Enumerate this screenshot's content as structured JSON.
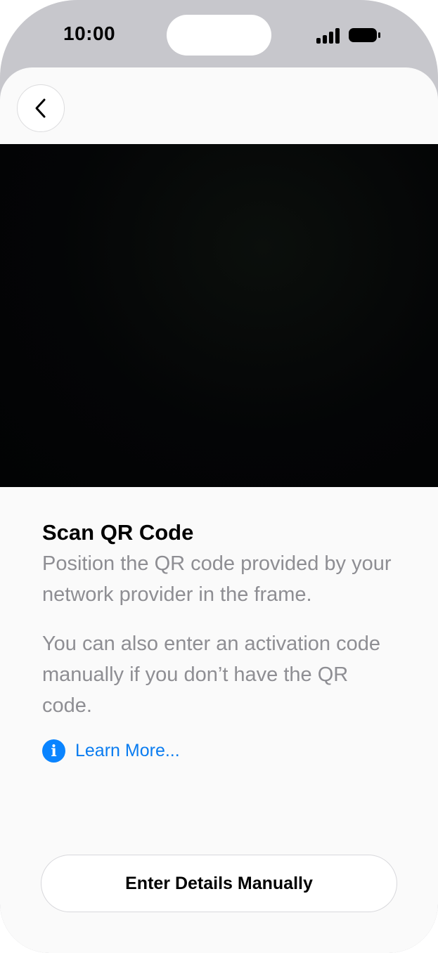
{
  "status_bar": {
    "time": "10:00",
    "signal_icon": "cellular-signal-icon",
    "battery_icon": "battery-icon"
  },
  "nav": {
    "back_icon": "chevron-left-icon"
  },
  "camera": {
    "description_icon": "camera-viewfinder"
  },
  "content": {
    "title": "Scan QR Code",
    "paragraph1": "Position the QR code provided by your network provider in the frame.",
    "paragraph2": "You can also enter an activation code manually if you don’t have the QR code.",
    "learn_more_label": "Learn More...",
    "info_icon_glyph": "i"
  },
  "actions": {
    "manual_button_label": "Enter Details Manually"
  },
  "colors": {
    "accent": "#0A84FF",
    "secondary_text": "#8E8E93",
    "camera_bg": "#030405"
  }
}
